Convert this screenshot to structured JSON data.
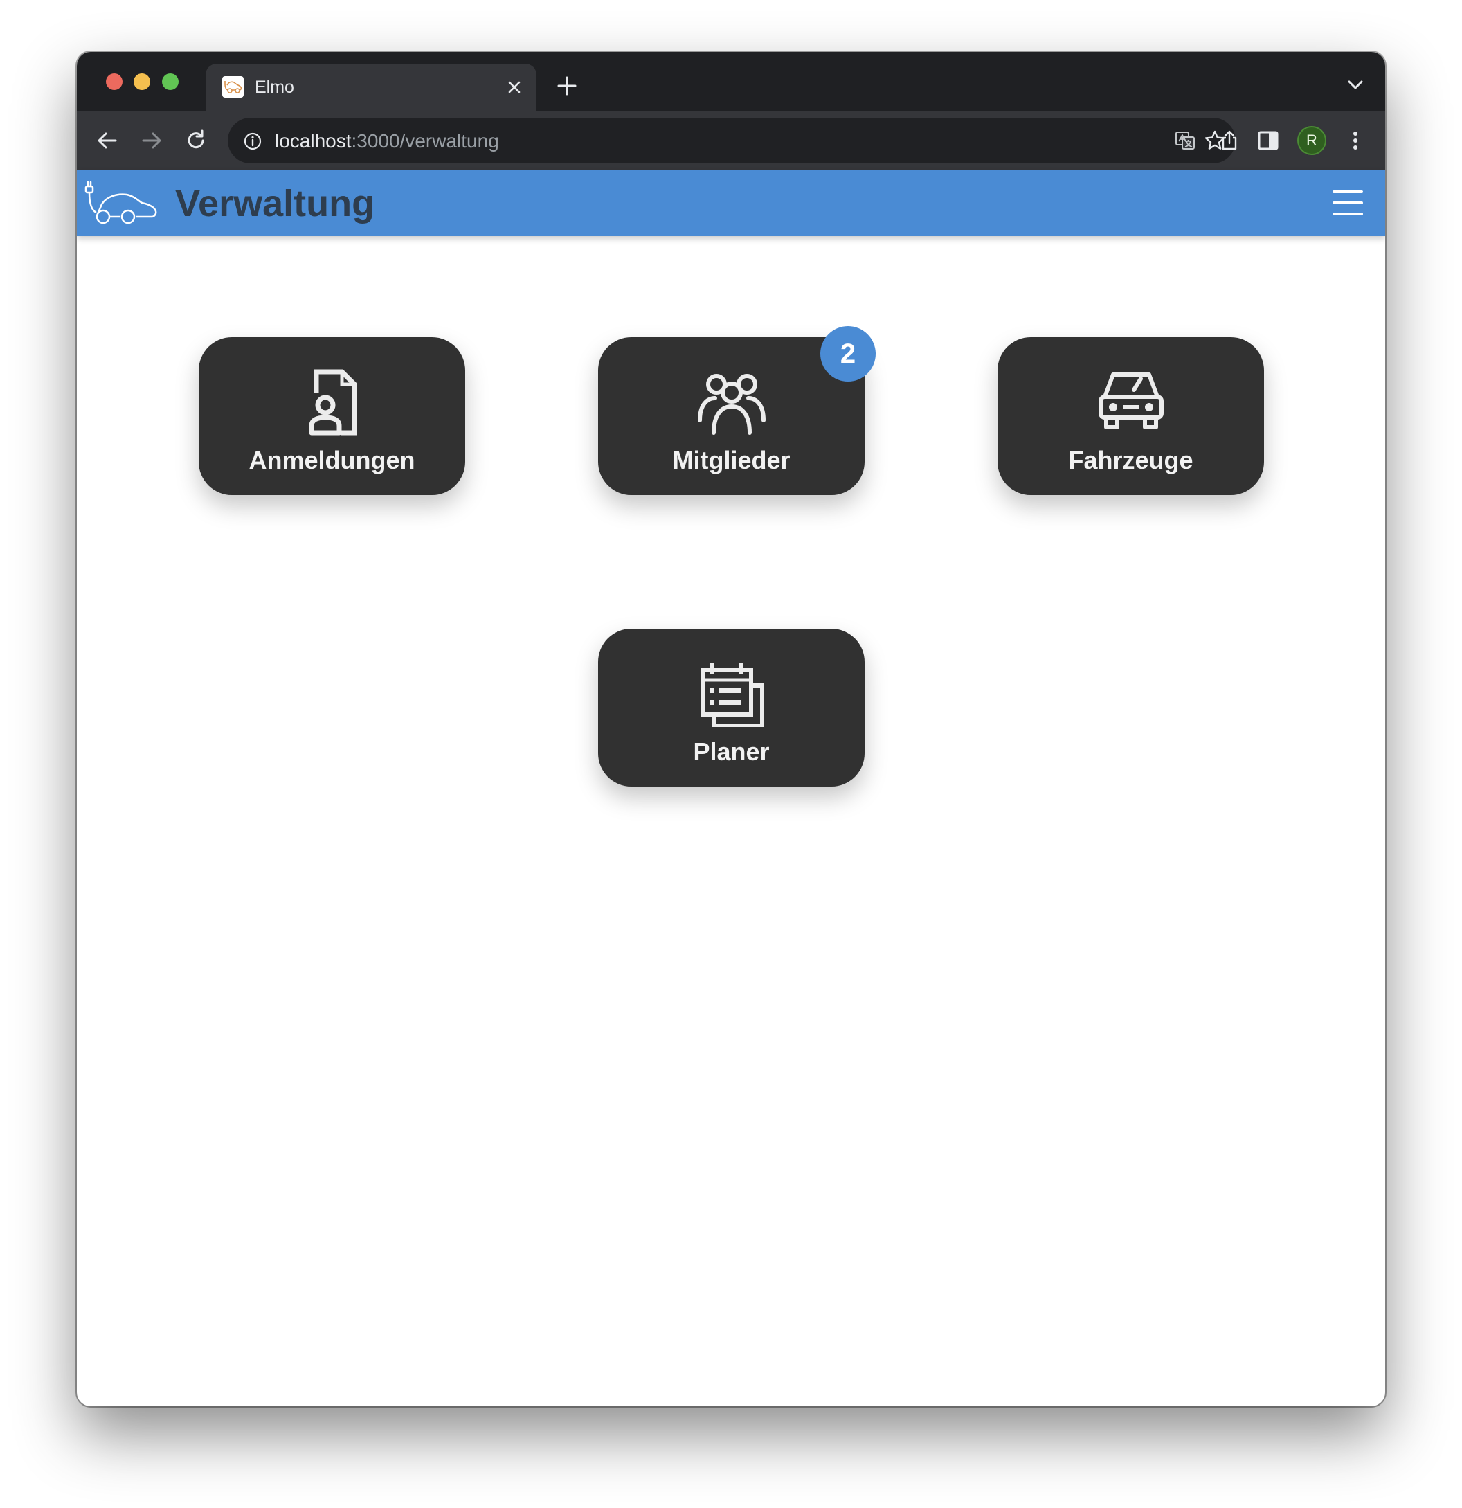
{
  "browser": {
    "tab_title": "Elmo",
    "url_host": "localhost",
    "url_path": ":3000/verwaltung",
    "profile_initial": "R"
  },
  "header": {
    "title": "Verwaltung"
  },
  "tiles": [
    {
      "label": "Anmeldungen",
      "icon": "document-person-icon"
    },
    {
      "label": "Mitglieder",
      "icon": "people-group-icon",
      "badge": "2"
    },
    {
      "label": "Fahrzeuge",
      "icon": "car-icon"
    },
    {
      "label": "Planer",
      "icon": "calendar-list-icon"
    }
  ],
  "colors": {
    "header_bg": "#4a8bd4",
    "header_title": "#2e3d4e",
    "tile_bg": "#313131",
    "badge_bg": "#4a8bd4"
  }
}
